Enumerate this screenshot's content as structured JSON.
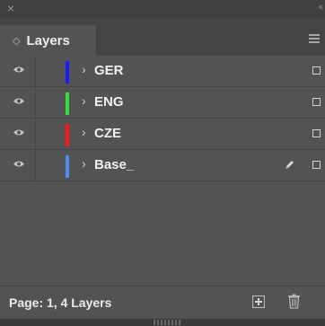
{
  "window": {
    "close_icon": "close-icon",
    "collapse_icon": "double-chevron-icon"
  },
  "tab": {
    "label": "Layers",
    "icon": "sort-arrows-icon"
  },
  "layers": [
    {
      "name": "GER",
      "color": "#1b1bff",
      "visible": true,
      "locked_edit_icon": false
    },
    {
      "name": "ENG",
      "color": "#34e03a",
      "visible": true,
      "locked_edit_icon": false
    },
    {
      "name": "CZE",
      "color": "#ff1717",
      "visible": true,
      "locked_edit_icon": false
    },
    {
      "name": "Base_",
      "color": "#4d8cf0",
      "visible": true,
      "locked_edit_icon": true
    }
  ],
  "footer": {
    "status": "Page: 1, 4 Layers",
    "new_layer_icon": "new-layer-icon",
    "delete_icon": "trash-icon"
  }
}
